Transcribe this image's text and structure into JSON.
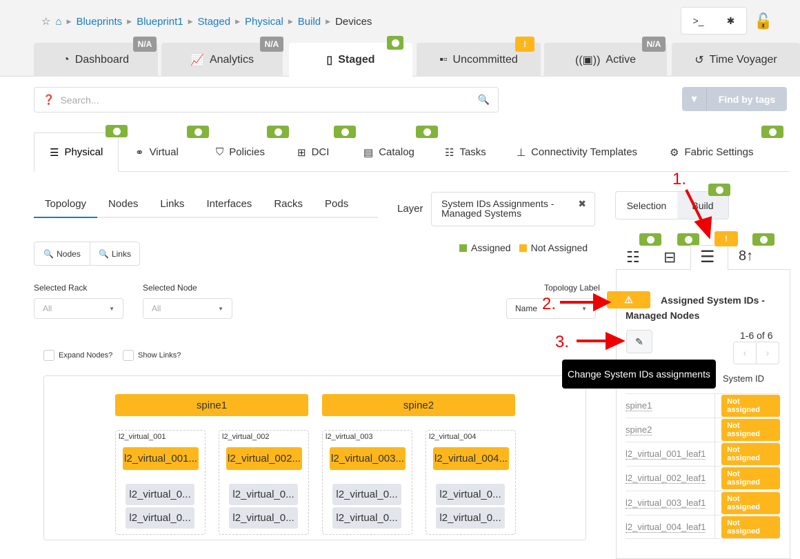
{
  "breadcrumb": [
    "Blueprints",
    "Blueprint1",
    "Staged",
    "Physical",
    "Build",
    "Devices"
  ],
  "main_tabs": [
    {
      "label": "Dashboard",
      "badge": "N/A"
    },
    {
      "label": "Analytics",
      "badge": "N/A"
    },
    {
      "label": "Staged",
      "badge": "ok"
    },
    {
      "label": "Uncommitted",
      "badge": "!"
    },
    {
      "label": "Active",
      "badge": "N/A"
    },
    {
      "label": "Time Voyager"
    }
  ],
  "search": {
    "placeholder": "Search...",
    "find_by_tags": "Find by tags"
  },
  "sub_tabs": [
    "Physical",
    "Virtual",
    "Policies",
    "DCI",
    "Catalog",
    "Tasks",
    "Connectivity Templates",
    "Fabric Settings"
  ],
  "topo_tabs": [
    "Topology",
    "Nodes",
    "Links",
    "Interfaces",
    "Racks",
    "Pods"
  ],
  "layer": {
    "label": "Layer",
    "value": "System IDs Assignments - Managed Systems"
  },
  "mode": {
    "selection": "Selection",
    "build": "Build"
  },
  "legend": {
    "assigned": "Assigned",
    "not_assigned": "Not Assigned",
    "assigned_color": "#82b33b",
    "not_assigned_color": "#fdb71c"
  },
  "search_buttons": {
    "nodes": "Nodes",
    "links": "Links"
  },
  "filters": {
    "rack_label": "Selected Rack",
    "rack_value": "All",
    "node_label": "Selected Node",
    "node_value": "All",
    "topo_label": "Topology Label",
    "topo_value": "Name"
  },
  "checkboxes": {
    "expand": "Expand Nodes?",
    "links": "Show Links?"
  },
  "topology": {
    "spines": [
      "spine1",
      "spine2"
    ],
    "racks": [
      {
        "name": "l2_virtual_001",
        "leaf": "l2_virtual_001...",
        "gen": [
          "l2_virtual_0...",
          "l2_virtual_0..."
        ]
      },
      {
        "name": "l2_virtual_002",
        "leaf": "l2_virtual_002...",
        "gen": [
          "l2_virtual_0...",
          "l2_virtual_0..."
        ]
      },
      {
        "name": "l2_virtual_003",
        "leaf": "l2_virtual_003...",
        "gen": [
          "l2_virtual_0...",
          "l2_virtual_0..."
        ]
      },
      {
        "name": "l2_virtual_004",
        "leaf": "l2_virtual_004...",
        "gen": [
          "l2_virtual_0...",
          "l2_virtual_0..."
        ]
      }
    ]
  },
  "panel": {
    "title": "Assigned System IDs - Managed Nodes",
    "pagination": "1-6 of 6",
    "tooltip": "Change System IDs assignments",
    "col_system_id": "System ID",
    "rows": [
      {
        "name": "spine1",
        "status": "Not assigned"
      },
      {
        "name": "spine2",
        "status": "Not assigned"
      },
      {
        "name": "l2_virtual_001_leaf1",
        "status": "Not assigned"
      },
      {
        "name": "l2_virtual_002_leaf1",
        "status": "Not assigned"
      },
      {
        "name": "l2_virtual_003_leaf1",
        "status": "Not assigned"
      },
      {
        "name": "l2_virtual_004_leaf1",
        "status": "Not assigned"
      }
    ]
  },
  "annotations": [
    "1.",
    "2.",
    "3."
  ]
}
